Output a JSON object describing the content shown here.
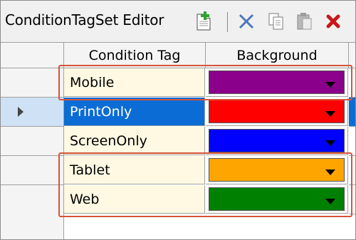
{
  "toolbar": {
    "title": "ConditionTagSet Editor",
    "buttons": [
      {
        "name": "new-icon"
      },
      {
        "name": "cut-icon"
      },
      {
        "name": "copy-icon"
      },
      {
        "name": "paste-icon"
      },
      {
        "name": "delete-icon"
      }
    ]
  },
  "grid": {
    "columns": [
      "Condition Tag",
      "Background"
    ],
    "rows": [
      {
        "name": "Mobile",
        "color": "#8B008B",
        "selected": false,
        "highlighted": true
      },
      {
        "name": "PrintOnly",
        "color": "#FF0000",
        "selected": true,
        "highlighted": false
      },
      {
        "name": "ScreenOnly",
        "color": "#0000FF",
        "selected": false,
        "highlighted": false
      },
      {
        "name": "Tablet",
        "color": "#FFA500",
        "selected": false,
        "highlighted": true
      },
      {
        "name": "Web",
        "color": "#008000",
        "selected": false,
        "highlighted": true
      }
    ]
  },
  "colors": {
    "callout": "#d6543a",
    "selection": "#0a6cd4",
    "cell_background": "#fff9e3"
  }
}
